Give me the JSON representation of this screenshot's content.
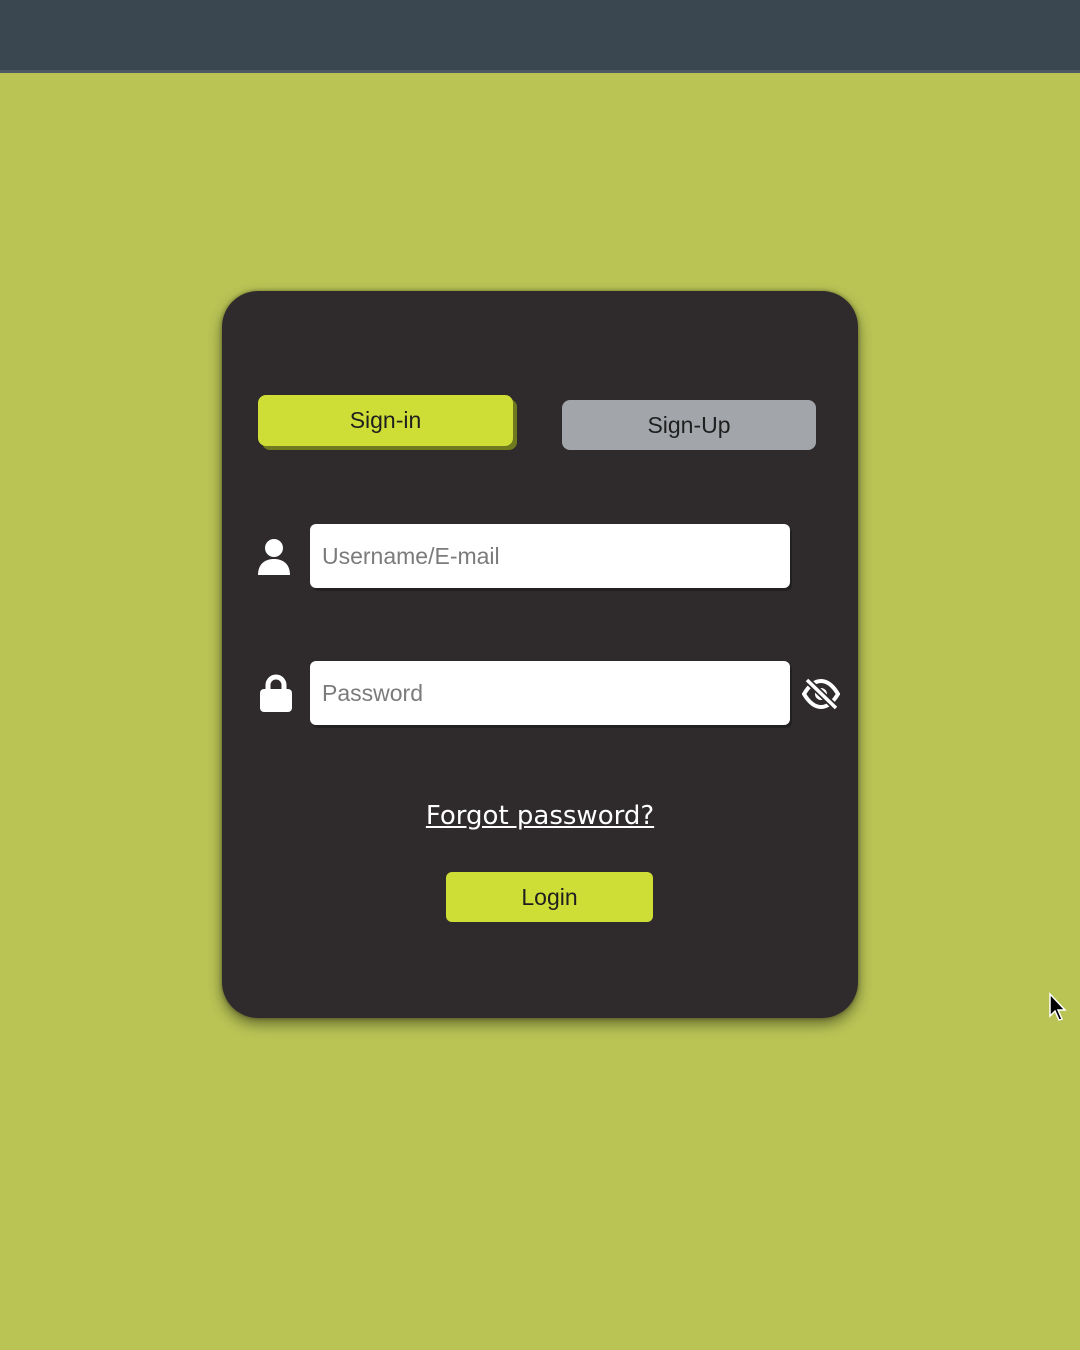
{
  "colors": {
    "page_background": "#b9c455",
    "top_bar": "#3b4750",
    "card": "#2f2b2c",
    "accent": "#cfde36",
    "inactive_tab": "#a2a6ab",
    "field": "#ffffff",
    "icon": "#ffffff"
  },
  "tabs": {
    "signin_label": "Sign-in",
    "signup_label": "Sign-Up",
    "active": "signin"
  },
  "form": {
    "username": {
      "icon": "user-icon",
      "placeholder": "Username/E-mail",
      "value": ""
    },
    "password": {
      "icon": "lock-icon",
      "placeholder": "Password",
      "value": "",
      "toggle_icon": "eye-slash-icon"
    },
    "forgot_label": "Forgot password?",
    "login_label": "Login"
  }
}
